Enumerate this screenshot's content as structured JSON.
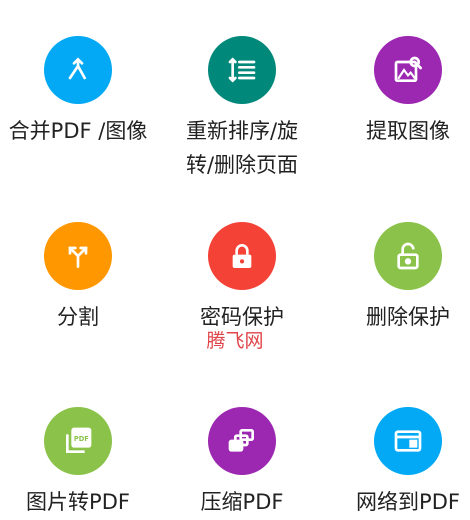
{
  "tools": [
    {
      "label": "合并PDF /图像",
      "color": "#03A9F4",
      "icon": "merge-icon"
    },
    {
      "label": "重新排序/旋转/删除页面",
      "color": "#00897B",
      "icon": "reorder-icon"
    },
    {
      "label": "提取图像",
      "color": "#9C27B0",
      "icon": "image-search-icon"
    },
    {
      "label": "分割",
      "color": "#FF9800",
      "icon": "split-icon"
    },
    {
      "label": "密码保护",
      "color": "#F44336",
      "icon": "lock-icon"
    },
    {
      "label": "删除保护",
      "color": "#8BC34A",
      "icon": "unlock-icon"
    },
    {
      "label": "图片转PDF",
      "color": "#8BC34A",
      "icon": "pdf-icon"
    },
    {
      "label": "压缩PDF",
      "color": "#9C27B0",
      "icon": "compress-icon"
    },
    {
      "label": "网络到PDF",
      "color": "#03A9F4",
      "icon": "web-icon"
    }
  ],
  "watermark": "腾飞网"
}
